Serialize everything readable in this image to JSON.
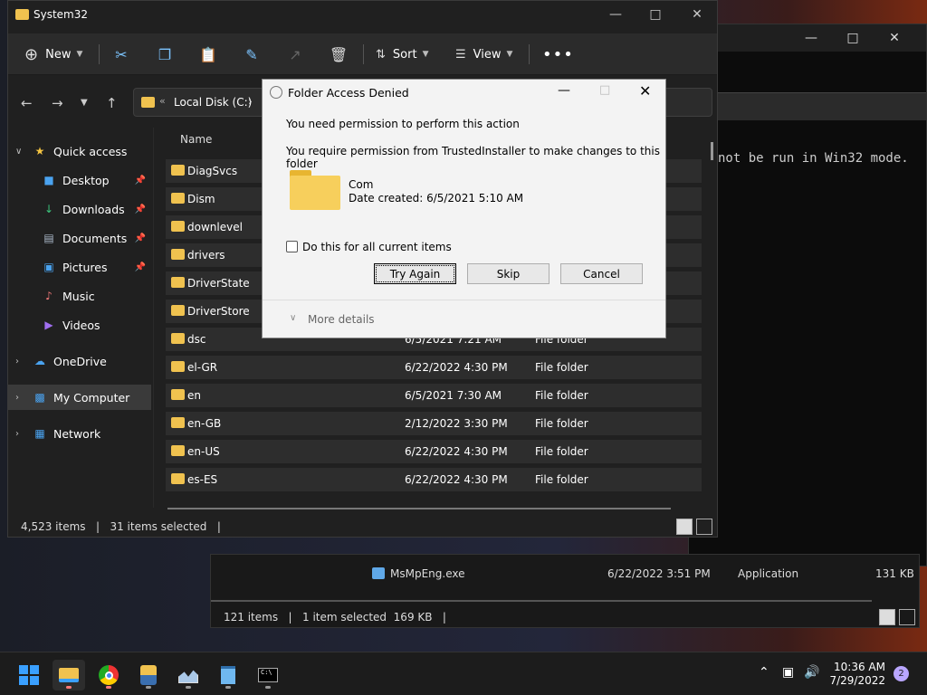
{
  "explorer": {
    "title": "System32",
    "cmdbar": {
      "new_label": "New",
      "sort_label": "Sort",
      "view_label": "View"
    },
    "address": {
      "crumb": "Local Disk (C:)"
    },
    "column_name": "Name",
    "sidebar": [
      {
        "label": "Quick access",
        "icon": "star-icon"
      },
      {
        "label": "Desktop",
        "icon": "desktop-icon"
      },
      {
        "label": "Downloads",
        "icon": "download-icon"
      },
      {
        "label": "Documents",
        "icon": "document-icon"
      },
      {
        "label": "Pictures",
        "icon": "pictures-icon"
      },
      {
        "label": "Music",
        "icon": "music-icon"
      },
      {
        "label": "Videos",
        "icon": "videos-icon"
      },
      {
        "label": "OneDrive",
        "icon": "cloud-icon"
      },
      {
        "label": "My Computer",
        "icon": "computer-icon"
      },
      {
        "label": "Network",
        "icon": "network-icon"
      }
    ],
    "files": [
      {
        "name": "DiagSvcs",
        "date": "",
        "type": ""
      },
      {
        "name": "Dism",
        "date": "",
        "type": ""
      },
      {
        "name": "downlevel",
        "date": "",
        "type": ""
      },
      {
        "name": "drivers",
        "date": "",
        "type": ""
      },
      {
        "name": "DriverState",
        "date": "",
        "type": ""
      },
      {
        "name": "DriverStore",
        "date": "",
        "type": ""
      },
      {
        "name": "dsc",
        "date": "6/5/2021 7:21 AM",
        "type": "File folder"
      },
      {
        "name": "el-GR",
        "date": "6/22/2022 4:30 PM",
        "type": "File folder"
      },
      {
        "name": "en",
        "date": "6/5/2021 7:30 AM",
        "type": "File folder"
      },
      {
        "name": "en-GB",
        "date": "2/12/2022 3:30 PM",
        "type": "File folder"
      },
      {
        "name": "en-US",
        "date": "6/22/2022 4:30 PM",
        "type": "File folder"
      },
      {
        "name": "es-ES",
        "date": "6/22/2022 4:30 PM",
        "type": "File folder"
      }
    ],
    "status": "4,523 items   |   31 items selected   |"
  },
  "bg_explorer": {
    "file_name": "MsMpEng.exe",
    "file_date": "6/22/2022 3:51 PM",
    "file_type": "Application",
    "file_size": "131 KB",
    "status": "121 items   |   1 item selected  169 KB   |"
  },
  "cmd": {
    "text": "not be run in Win32 mode."
  },
  "dialog": {
    "title": "Folder Access Denied",
    "line1": "You need permission to perform this action",
    "line2": "You require permission from TrustedInstaller to make changes to this folder",
    "folder_name": "Com",
    "folder_date": "Date created: 6/5/2021 5:10 AM",
    "checkbox_label": "Do this for all current items",
    "try_again": "Try Again",
    "skip": "Skip",
    "cancel": "Cancel",
    "more_details": "More details"
  },
  "taskbar": {
    "time": "10:36 AM",
    "date": "7/29/2022",
    "notifications": "2"
  }
}
